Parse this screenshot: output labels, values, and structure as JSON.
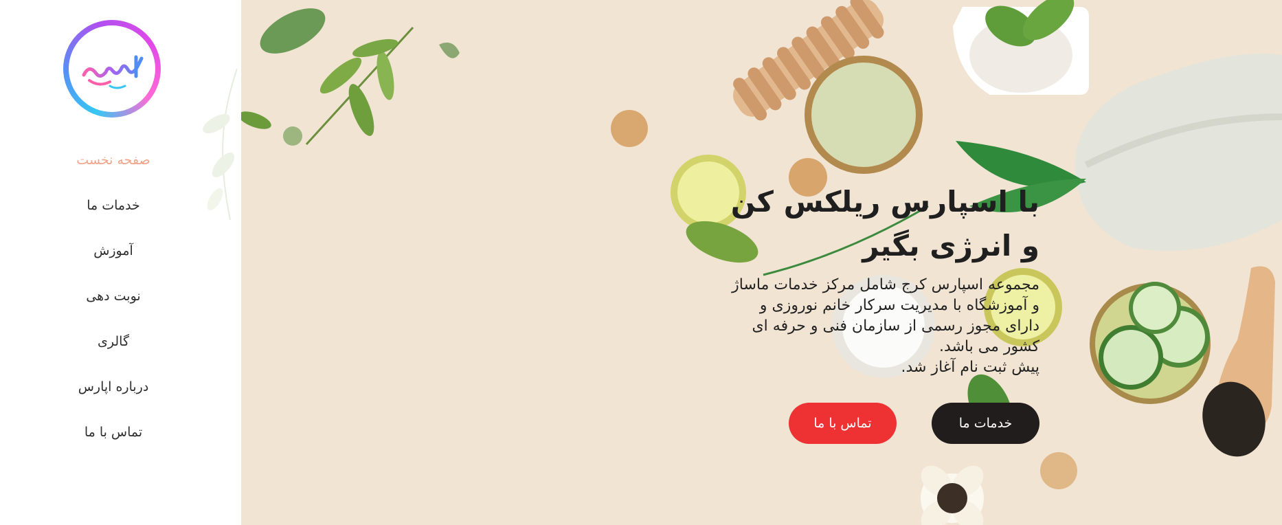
{
  "brand": {
    "logo_text": "اسپارس",
    "colors": {
      "ring_start": "#35c7f3",
      "ring_end": "#ff6ad5"
    }
  },
  "sidebar": {
    "items": [
      {
        "label": "صفحه نخست",
        "active": true
      },
      {
        "label": "خدمات ما",
        "active": false
      },
      {
        "label": "آموزش",
        "active": false
      },
      {
        "label": "نوبت دهی",
        "active": false
      },
      {
        "label": "گالری",
        "active": false
      },
      {
        "label": "درباره اپارس",
        "active": false
      },
      {
        "label": "تماس با ما",
        "active": false
      }
    ]
  },
  "hero": {
    "title": "با اسپارس ریلکس کن و انرژی بگیر",
    "description": "مجموعه اسپارس کرج شامل مرکز خدمات ماساژ و آموزشگاه با مدیریت سرکار خانم نوروزی و دارای مجوز رسمی از سازمان فنی و حرفه ای کشور می باشد.",
    "description_line2": "پیش ثبت نام آغاز شد.",
    "buttons": {
      "services": "خدمات ما",
      "contact": "تماس با ما"
    }
  },
  "colors": {
    "active_nav": "#f0a58a",
    "hero_bg": "#f1e4d3",
    "button_dark": "#211d1c",
    "button_red": "#ee3133"
  }
}
